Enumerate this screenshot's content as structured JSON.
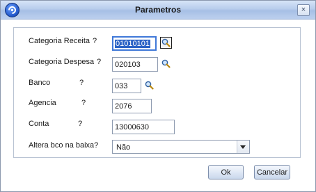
{
  "window": {
    "title": "Parametros",
    "close_glyph": "×",
    "app_icon": "protheus-logo-icon",
    "close_icon": "close-icon"
  },
  "form": {
    "categoria_receita": {
      "label": "Categoria Receita",
      "help": "?",
      "value": "01010101",
      "lookup_icon": "search-icon"
    },
    "categoria_despesa": {
      "label": "Categoria Despesa",
      "help": "?",
      "value": "020103",
      "lookup_icon": "search-icon"
    },
    "banco": {
      "label": "Banco",
      "help": "?",
      "value": "033",
      "lookup_icon": "search-icon"
    },
    "agencia": {
      "label": "Agencia",
      "help": "?",
      "value": "2076"
    },
    "conta": {
      "label": "Conta",
      "help": "?",
      "value": "13000630"
    },
    "altera_bco": {
      "label": "Altera bco na baixa?",
      "selected": "Não"
    }
  },
  "buttons": {
    "ok": "Ok",
    "cancel": "Cancelar"
  },
  "colors": {
    "selection": "#2b63c6",
    "focus_border": "#3f78d8",
    "titlebar": "#b8cdec"
  }
}
